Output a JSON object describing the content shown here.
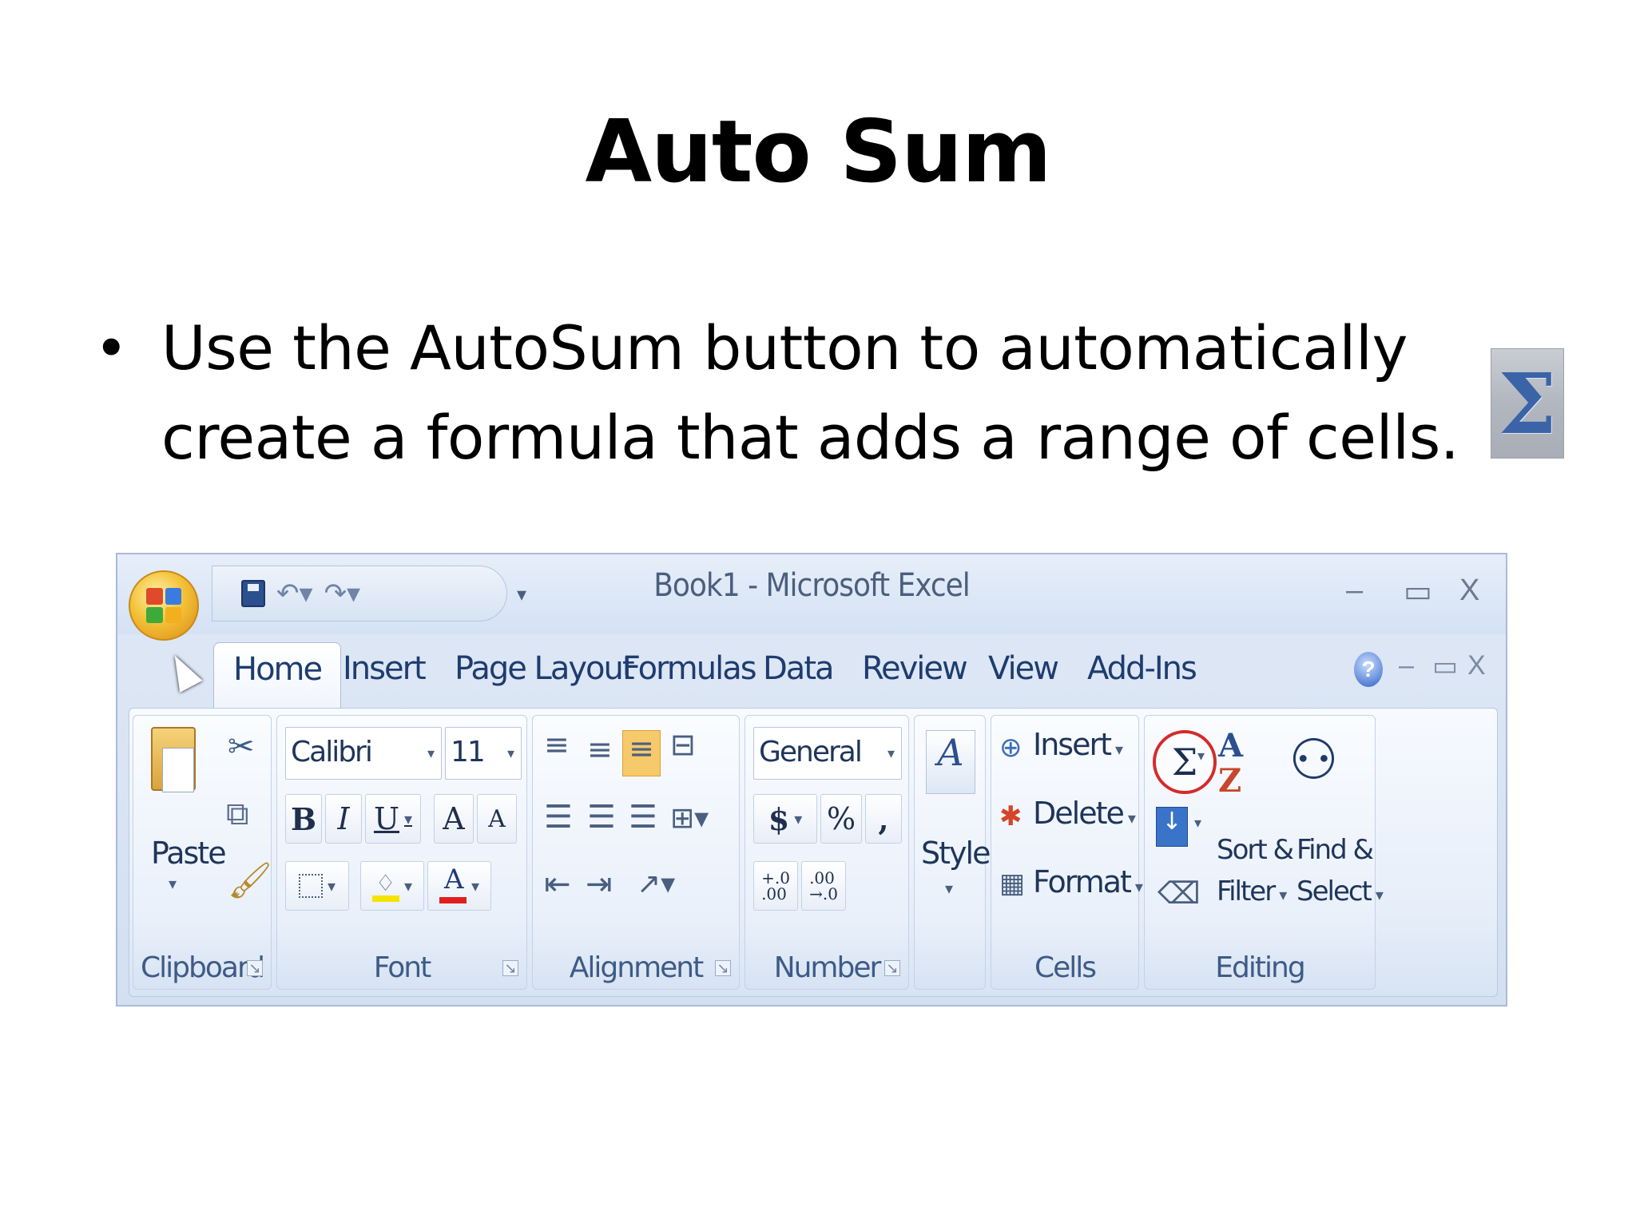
{
  "slide": {
    "title": "Auto Sum",
    "bullet": "Use the AutoSum button to automatically create a formula that adds a range of cells.",
    "sigma_icon": "sigma-icon"
  },
  "excel": {
    "window_title": "Book1 - Microsoft Excel",
    "window_controls": {
      "minimize": "–",
      "restore": "▭",
      "close": "X"
    },
    "tabs": [
      "Home",
      "Insert",
      "Page Layout",
      "Formulas",
      "Data",
      "Review",
      "View",
      "Add-Ins"
    ],
    "active_tab": "Home",
    "help": "?",
    "groups": {
      "clipboard": {
        "label": "Clipboard",
        "paste": "Paste"
      },
      "font": {
        "label": "Font",
        "font_name": "Calibri",
        "font_size": "11",
        "bold": "B",
        "italic": "I",
        "underline": "U",
        "grow": "A",
        "shrink": "A"
      },
      "alignment": {
        "label": "Alignment"
      },
      "number": {
        "label": "Number",
        "format": "General",
        "currency": "$",
        "percent": "%",
        "comma": ","
      },
      "styles": {
        "label": "Styles"
      },
      "cells": {
        "label": "Cells",
        "insert": "Insert",
        "delete": "Delete",
        "format": "Format"
      },
      "editing": {
        "label": "Editing",
        "sigma": "Σ",
        "sort": "Sort &",
        "filter": "Filter",
        "find": "Find &",
        "select": "Select"
      }
    },
    "colors": {
      "highlight": "#f5e400",
      "font_color": "#e21f1f",
      "autosum_circle": "#d42b2b"
    }
  }
}
